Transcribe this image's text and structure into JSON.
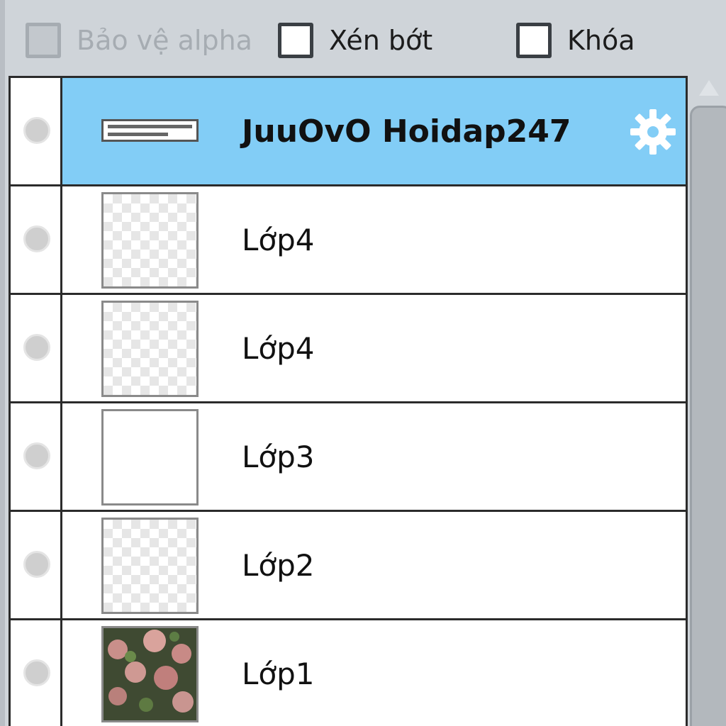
{
  "options": {
    "protect_alpha": {
      "label": "Bảo vệ alpha",
      "checked": false,
      "enabled": false
    },
    "clip": {
      "label": "Xén bớt",
      "checked": false,
      "enabled": true
    },
    "lock": {
      "label": "Khóa",
      "checked": false,
      "enabled": true
    }
  },
  "layers": [
    {
      "name": "JuuOvO Hoidap247",
      "selected": true,
      "thumbnail": "text"
    },
    {
      "name": "Lớp4",
      "selected": false,
      "thumbnail": "transparent"
    },
    {
      "name": "Lớp4",
      "selected": false,
      "thumbnail": "transparent"
    },
    {
      "name": "Lớp3",
      "selected": false,
      "thumbnail": "white-frame"
    },
    {
      "name": "Lớp2",
      "selected": false,
      "thumbnail": "transparent"
    },
    {
      "name": "Lớp1",
      "selected": false,
      "thumbnail": "photo-roses"
    }
  ],
  "colors": {
    "selected_row": "#82cdf6",
    "panel_bg": "#cfd4d9",
    "gear": "#ffffff"
  },
  "icons": {
    "settings": "gear-icon",
    "visibility": "visibility-dot-icon",
    "scroll_up": "chevron-up-icon"
  }
}
